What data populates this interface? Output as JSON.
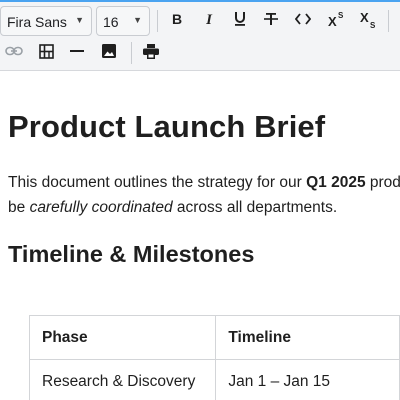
{
  "toolbar": {
    "font_family": "Fira Sans",
    "font_size": "16",
    "buttons": [
      "bold",
      "italic",
      "underline",
      "strikethrough",
      "code",
      "superscript",
      "subscript",
      "link",
      "table",
      "horizontal-rule",
      "image",
      "print"
    ]
  },
  "document": {
    "title": "Product Launch Brief",
    "para_1_a": "This document outlines the strategy for our ",
    "para_1_bold": "Q1 2025",
    "para_1_b": " product",
    "para_2_a": "be ",
    "para_2_italic": "carefully coordinated",
    "para_2_b": " across all departments.",
    "section_heading": "Timeline & Milestones",
    "table": {
      "headers": [
        "Phase",
        "Timeline"
      ],
      "rows": [
        [
          "Research & Discovery",
          "Jan 1 – Jan 15"
        ]
      ]
    }
  },
  "colors": {
    "accent": "#4aa3f0",
    "toolbar_bg": "#f3f4f6",
    "border": "#d3d5d8"
  }
}
